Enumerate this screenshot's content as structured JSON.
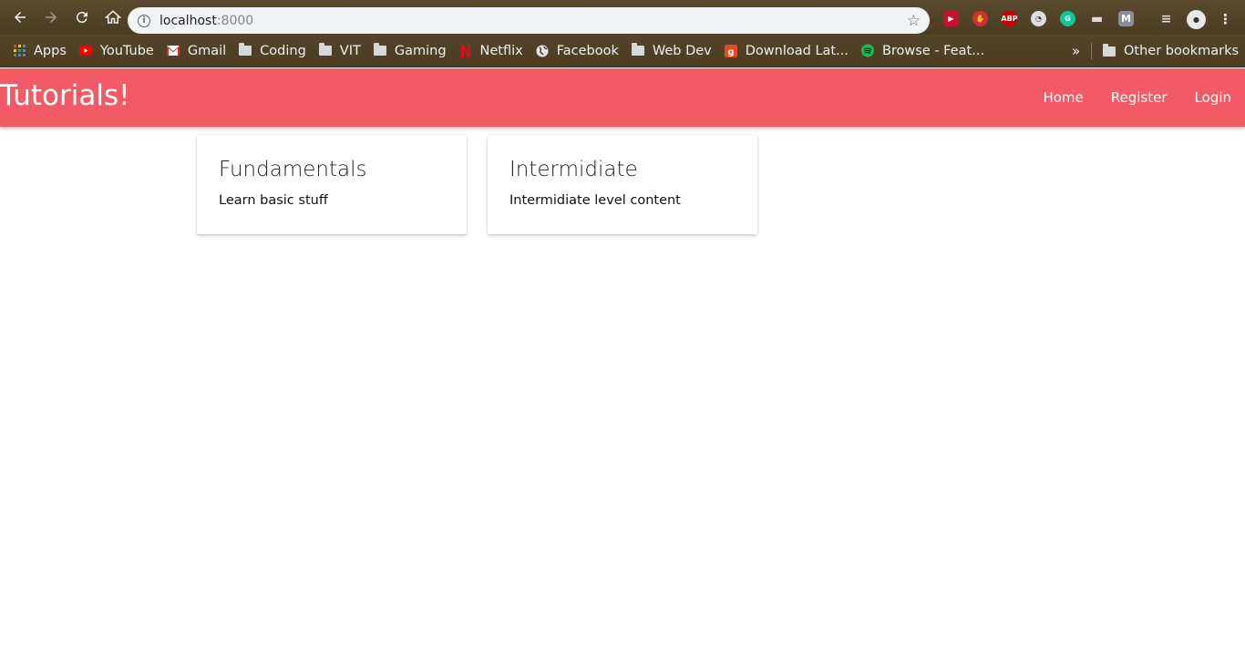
{
  "browser": {
    "url_host": "localhost",
    "url_port": ":8000",
    "bookmarks": [
      {
        "label": "Apps",
        "icon": "apps-grid-icon"
      },
      {
        "label": "YouTube",
        "icon": "youtube-icon"
      },
      {
        "label": "Gmail",
        "icon": "gmail-icon"
      },
      {
        "label": "Coding",
        "icon": "folder-icon"
      },
      {
        "label": "VIT",
        "icon": "folder-icon"
      },
      {
        "label": "Gaming",
        "icon": "folder-icon"
      },
      {
        "label": "Netflix",
        "icon": "netflix-icon"
      },
      {
        "label": "Facebook",
        "icon": "globe-icon"
      },
      {
        "label": "Web Dev",
        "icon": "folder-icon"
      },
      {
        "label": "Download Lat...",
        "icon": "download-site-icon"
      },
      {
        "label": "Browse - Feat...",
        "icon": "spotify-icon"
      }
    ],
    "more_label": "»",
    "other_bookmarks": "Other bookmarks",
    "extensions": {
      "adblock_label": "ABP",
      "profile_letter": "M"
    }
  },
  "page": {
    "brand": "Tutorials!",
    "nav": {
      "home": "Home",
      "register": "Register",
      "login": "Login"
    },
    "cards": [
      {
        "title": "Fundamentals",
        "text": "Learn basic stuff"
      },
      {
        "title": "Intermidiate",
        "text": "Intermidiate level content"
      }
    ]
  },
  "colors": {
    "navbar": "#f25b66",
    "chrome": "#544429"
  }
}
